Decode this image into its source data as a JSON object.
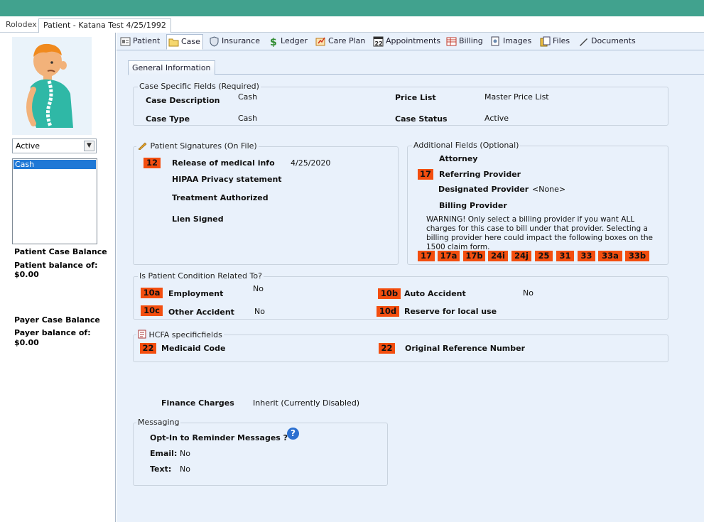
{
  "window_tabs": [
    "Rolodex",
    "Patient - Katana Test 4/25/1992"
  ],
  "sidebar": {
    "status": "Active",
    "cases": [
      "Cash"
    ],
    "patient_balance_title": "Patient Case Balance",
    "patient_balance_label": "Patient balance of:",
    "patient_balance_value": "$0.00",
    "payer_balance_title": "Payer Case Balance",
    "payer_balance_label": "Payer balance of:",
    "payer_balance_value": "$0.00"
  },
  "tabs": [
    {
      "label": "Patient",
      "icon": "patient-card-icon"
    },
    {
      "label": "Case",
      "icon": "folder-icon"
    },
    {
      "label": "Insurance",
      "icon": "shield-icon"
    },
    {
      "label": "Ledger",
      "icon": "dollar-icon"
    },
    {
      "label": "Care Plan",
      "icon": "careplan-icon"
    },
    {
      "label": "Appointments",
      "icon": "calendar-icon"
    },
    {
      "label": "Billing",
      "icon": "billing-icon"
    },
    {
      "label": "Images",
      "icon": "images-icon"
    },
    {
      "label": "Files",
      "icon": "files-icon"
    },
    {
      "label": "Documents",
      "icon": "pen-icon"
    }
  ],
  "subtab": "General Information",
  "case_specific": {
    "title": "Case Specific Fields (Required)",
    "case_description_label": "Case Description",
    "case_description": "Cash",
    "case_type_label": "Case Type",
    "case_type": "Cash",
    "price_list_label": "Price List",
    "price_list": "Master Price List",
    "case_status_label": "Case Status",
    "case_status": "Active"
  },
  "signatures": {
    "title": "Patient Signatures (On File)",
    "badge": "12",
    "release_label": "Release of medical info",
    "release_date": "4/25/2020",
    "hipaa_label": "HIPAA Privacy statement",
    "treatment_label": "Treatment Authorized",
    "lien_label": "Lien Signed"
  },
  "additional": {
    "title": "Additional Fields (Optional)",
    "attorney_label": "Attorney",
    "referring_badge": "17",
    "referring_label": "Referring Provider",
    "designated_label": "Designated Provider",
    "designated_value": "<None>",
    "billing_label": "Billing Provider",
    "warning": "WARNING! Only select a billing provider if you want ALL charges for this case to bill under that provider.  Selecting a billing provider here could impact the following boxes on the 1500 claim form.",
    "boxes": [
      "17",
      "17a",
      "17b",
      "24i",
      "24j",
      "25",
      "31",
      "33",
      "33a",
      "33b"
    ]
  },
  "condition": {
    "title": "Is Patient Condition Related To?",
    "employment_badge": "10a",
    "employment_label": "Employment",
    "employment_value": "No",
    "other_badge": "10c",
    "other_label": "Other Accident",
    "other_value": "No",
    "auto_badge": "10b",
    "auto_label": "Auto Accident",
    "auto_value": "No",
    "reserve_badge": "10d",
    "reserve_label": "Reserve for local use"
  },
  "hcfa": {
    "title": "HCFA specificfields",
    "medicaid_badge": "22",
    "medicaid_label": "Medicaid Code",
    "original_badge": "22",
    "original_label": "Original Reference Number"
  },
  "finance": {
    "label": "Finance Charges",
    "value": "Inherit (Currently Disabled)"
  },
  "messaging": {
    "title": "Messaging",
    "optin_label": "Opt-In to Reminder Messages ?",
    "email_label": "Email:",
    "email_value": "No",
    "text_label": "Text:",
    "text_value": "No"
  },
  "colors": {
    "header": "#41a28e",
    "badge": "#f34e0f",
    "panel": "#e9f1fb",
    "selection": "#1f78d6"
  }
}
